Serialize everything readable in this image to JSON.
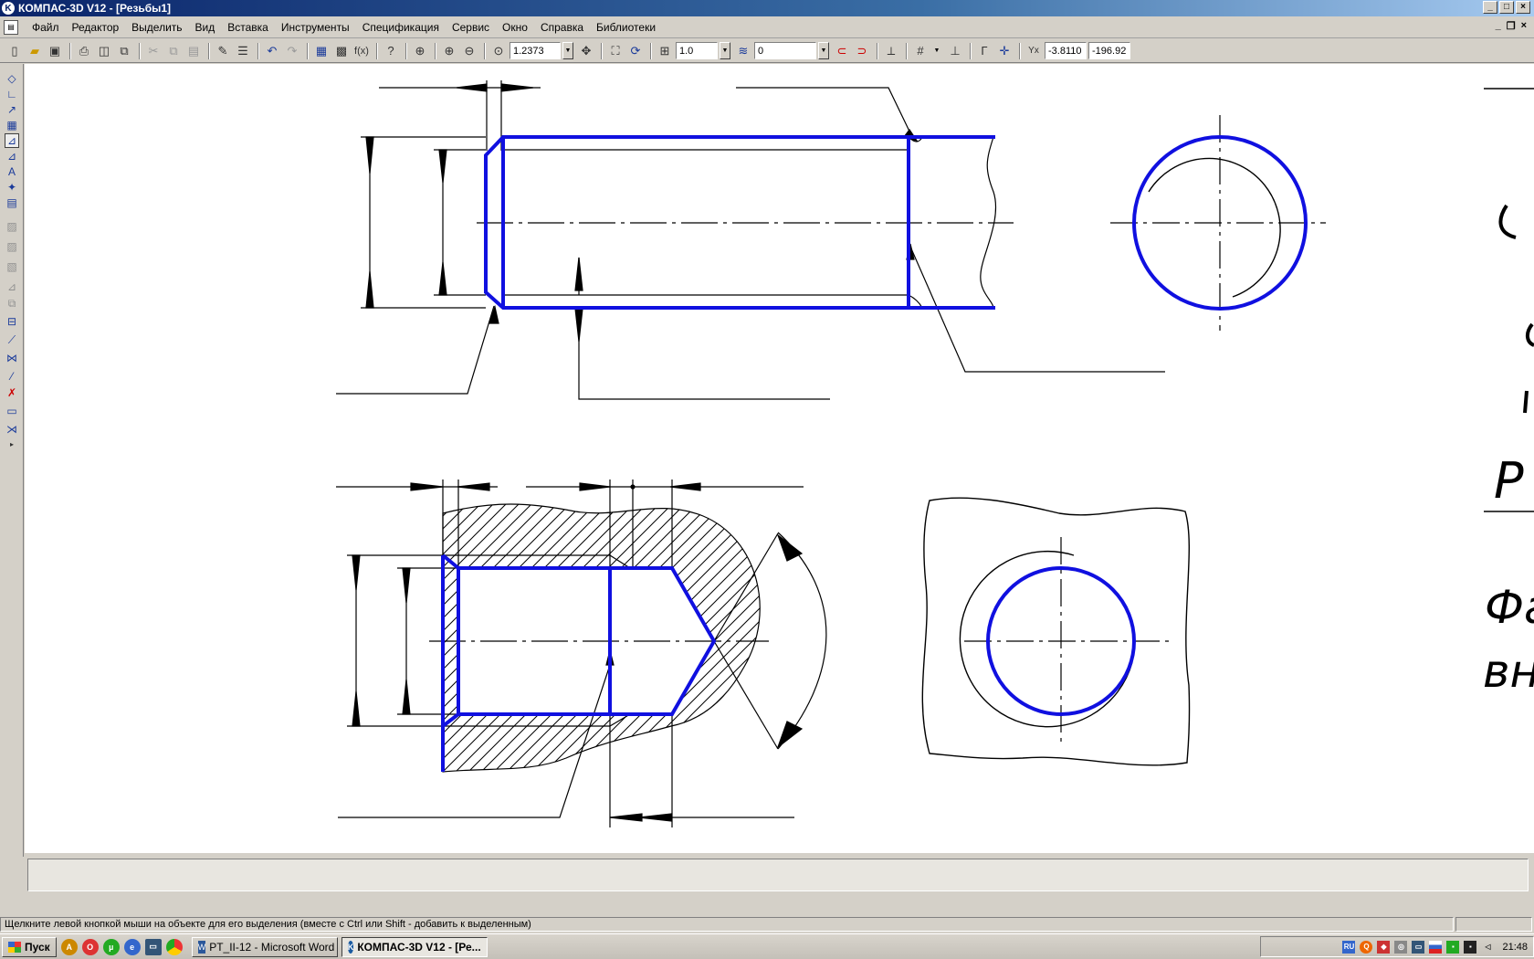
{
  "window": {
    "title": "КОМПАС-3D V12 - [Резьбы1]",
    "min": "_",
    "max": "□",
    "close": "×"
  },
  "menu": [
    "Файл",
    "Редактор",
    "Выделить",
    "Вид",
    "Вставка",
    "Инструменты",
    "Спецификация",
    "Сервис",
    "Окно",
    "Справка",
    "Библиотеки"
  ],
  "toolbar": {
    "zoom": "1.2373",
    "step": "1.0",
    "layer": "0",
    "coord_x": "-3.8110",
    "coord_y": "-196.92"
  },
  "sheet_text": [
    "Р",
    "Фа",
    "вн"
  ],
  "status": "Щелкните левой кнопкой мыши на объекте для его выделения (вместе с Ctrl или Shift - добавить к выделенным)",
  "taskbar": {
    "start": "Пуск",
    "tasks": [
      "PT_II-12 - Microsoft Word",
      "КОМПАС-3D V12 - [Ре..."
    ],
    "lang": "RU",
    "clock": "21:48"
  },
  "colors": {
    "thread_line": "#1010e0",
    "line": "#000000",
    "title_bg": "#0a246a"
  }
}
